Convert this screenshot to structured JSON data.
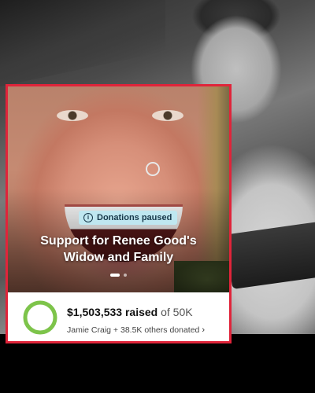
{
  "campaign": {
    "status_badge": "Donations paused",
    "status_icon": "info-icon",
    "title_line1": "Support for Renee Good's",
    "title_line2": "Widow and Family",
    "carousel": {
      "total": 2,
      "active": 1
    }
  },
  "fundraising": {
    "amount_raised": "$1,503,533",
    "raised_word": "raised",
    "goal_text": "of 50K",
    "progress_fraction": 1.0,
    "donors_text": "Jamie Craig + 38.5K others donated",
    "donors_chevron": "chevron-right-icon"
  },
  "colors": {
    "highlight_border": "#e0243a",
    "badge_bg": "#bfe7f0",
    "progress_green": "#7dc44a"
  }
}
